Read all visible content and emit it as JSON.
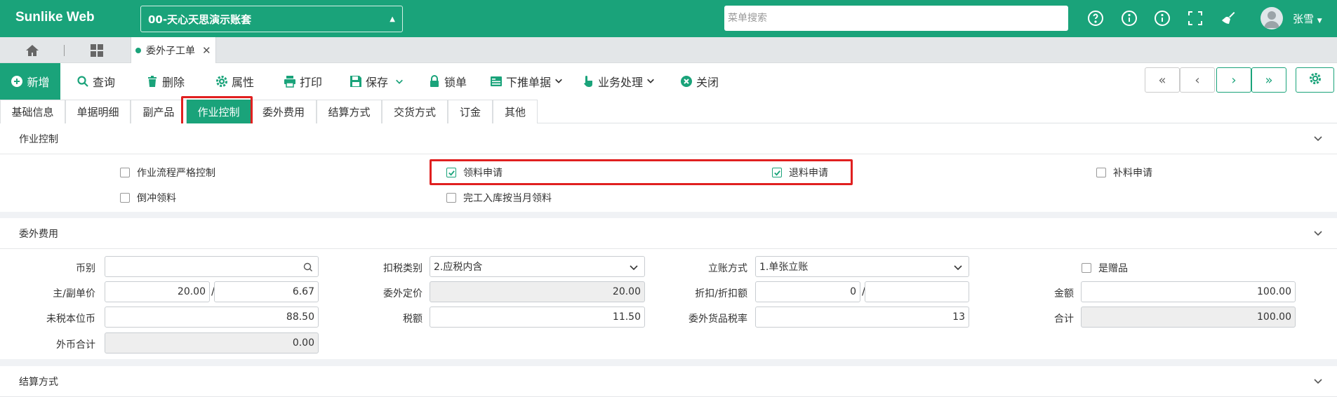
{
  "app": {
    "logo": "Sunlike Web",
    "account": "00-天心天思演示账套",
    "search_placeholder": "菜单搜索",
    "user": "张雪"
  },
  "tabs": {
    "doc_tab": "委外子工单"
  },
  "toolbar": {
    "new": "新增",
    "query": "查询",
    "delete": "删除",
    "properties": "属性",
    "print": "打印",
    "save": "保存",
    "lock": "锁单",
    "push_down": "下推单据",
    "business": "业务处理",
    "close": "关闭"
  },
  "form_tabs": [
    "基础信息",
    "单据明细",
    "副产品",
    "作业控制",
    "委外费用",
    "结算方式",
    "交货方式",
    "订金",
    "其他"
  ],
  "active_tab_index": 3,
  "sections": {
    "control": "作业控制",
    "fee": "委外费用",
    "settle": "结算方式"
  },
  "control": {
    "strict": {
      "label": "作业流程严格控制",
      "checked": false
    },
    "pick_apply": {
      "label": "领料申请",
      "checked": true
    },
    "return_apply": {
      "label": "退料申请",
      "checked": true
    },
    "supp_apply": {
      "label": "补料申请",
      "checked": false
    },
    "backflush": {
      "label": "倒冲领料",
      "checked": false
    },
    "month_pick": {
      "label": "完工入库按当月领料",
      "checked": false
    }
  },
  "fee": {
    "currency_label": "币别",
    "currency": "",
    "price_label": "主/副单价",
    "price_main": "20.00",
    "price_sub": "6.67",
    "untaxed_label": "未税本位币",
    "untaxed": "88.50",
    "foreign_total_label": "外币合计",
    "foreign_total": "0.00",
    "tax_type_label": "扣税类别",
    "tax_type": "2.应税内含",
    "outsource_price_label": "委外定价",
    "outsource_price": "20.00",
    "tax_label": "税额",
    "tax": "11.50",
    "account_label": "立账方式",
    "account": "1.单张立账",
    "discount_label": "折扣/折扣额",
    "discount": "0",
    "discount_amt": "",
    "goods_tax_rate_label": "委外货品税率",
    "goods_tax_rate": "13",
    "gift_label": "是赠品",
    "gift_checked": false,
    "amount_label": "金额",
    "amount": "100.00",
    "total_label": "合计",
    "total": "100.00"
  },
  "colors": {
    "primary": "#1aa37a",
    "highlight": "#e02020"
  }
}
